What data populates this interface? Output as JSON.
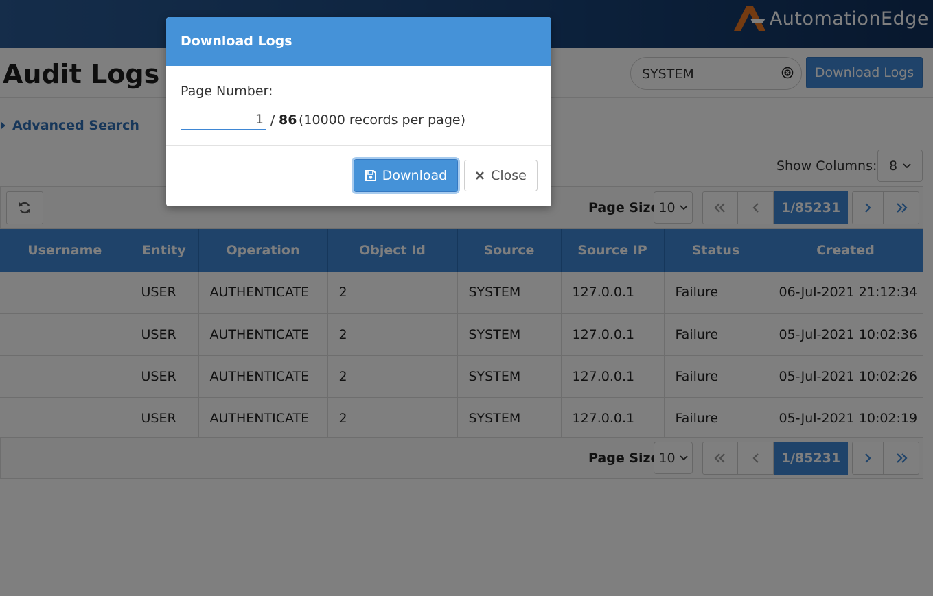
{
  "header": {
    "brand": "AutomationEdge",
    "brand_colors": {
      "orange": "#e87722",
      "white": "#ffffff"
    }
  },
  "page": {
    "title": "Audit Logs",
    "search": {
      "value": "SYSTEM",
      "clear_icon": "clear-circle-icon"
    },
    "download_logs_label": "Download Logs",
    "advanced_search_label": "Advanced Search",
    "show_columns": {
      "label": "Show Columns:",
      "value": "8"
    }
  },
  "toolbar": {
    "refresh_icon": "refresh-icon",
    "page_size_label": "Page Size",
    "page_size_value": "10",
    "current_page": "1/85231",
    "first_icon": "double-chevron-left-icon",
    "prev_icon": "chevron-left-icon",
    "next_icon": "chevron-right-icon",
    "last_icon": "double-chevron-right-icon"
  },
  "table": {
    "columns": [
      "Username",
      "Entity",
      "Operation",
      "Object Id",
      "Source",
      "Source IP",
      "Status",
      "Created"
    ],
    "rows": [
      [
        "",
        "USER",
        "AUTHENTICATE",
        "2",
        "SYSTEM",
        "127.0.0.1",
        "Failure",
        "06-Jul-2021 21:12:34"
      ],
      [
        "",
        "USER",
        "AUTHENTICATE",
        "2",
        "SYSTEM",
        "127.0.0.1",
        "Failure",
        "05-Jul-2021 10:02:36"
      ],
      [
        "",
        "USER",
        "AUTHENTICATE",
        "2",
        "SYSTEM",
        "127.0.0.1",
        "Failure",
        "05-Jul-2021 10:02:26"
      ],
      [
        "",
        "USER",
        "AUTHENTICATE",
        "2",
        "SYSTEM",
        "127.0.0.1",
        "Failure",
        "05-Jul-2021 10:02:19"
      ]
    ]
  },
  "modal": {
    "title": "Download Logs",
    "page_number_label": "Page Number:",
    "page_number_value": "1",
    "separator": "/",
    "total_pages": "86",
    "records_note": "(10000 records per page)",
    "download_label": "Download",
    "download_icon": "floppy-disk-icon",
    "close_label": "Close",
    "close_icon": "close-x-icon"
  },
  "colors": {
    "primary": "#3f87d4",
    "modal_header": "#4592d8",
    "link": "#2e6fb4"
  }
}
